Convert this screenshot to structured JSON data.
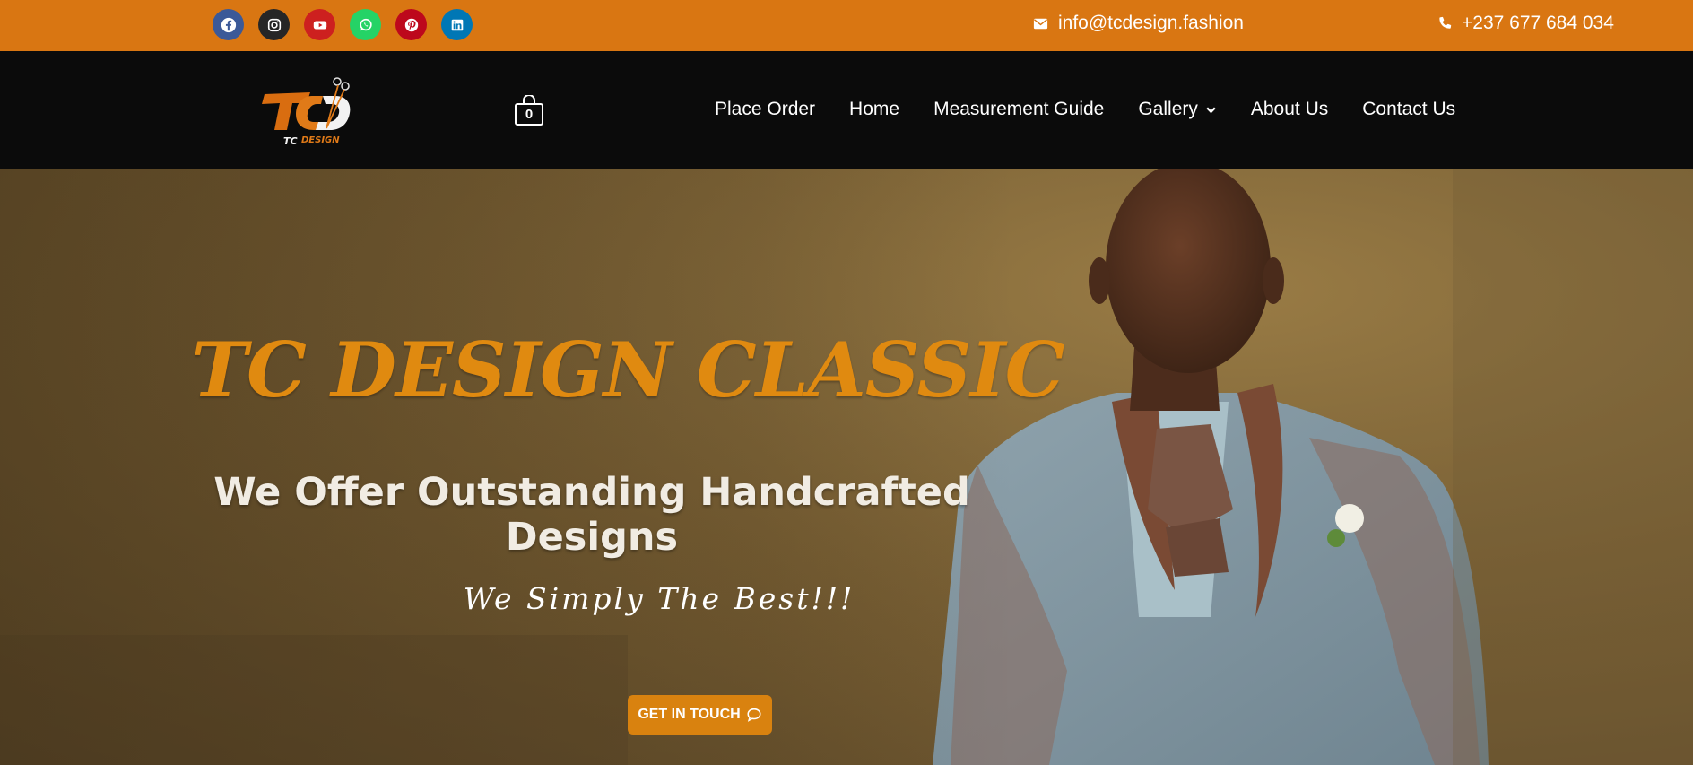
{
  "topbar": {
    "socials": [
      {
        "name": "facebook-icon",
        "color": "#3b5998"
      },
      {
        "name": "instagram-icon",
        "color": "#262626"
      },
      {
        "name": "youtube-icon",
        "color": "#cd201f"
      },
      {
        "name": "whatsapp-icon",
        "color": "#25d366"
      },
      {
        "name": "pinterest-icon",
        "color": "#bd081c"
      },
      {
        "name": "linkedin-icon",
        "color": "#0077b5"
      }
    ],
    "email": "info@tcdesign.fashion",
    "phone": "+237 677 684 034"
  },
  "header": {
    "cart_count": "0",
    "nav": [
      {
        "label": "Place Order"
      },
      {
        "label": "Home"
      },
      {
        "label": "Measurement Guide"
      },
      {
        "label": "Gallery"
      },
      {
        "label": "About Us"
      },
      {
        "label": "Contact Us"
      }
    ]
  },
  "hero": {
    "title": "TC DESIGN CLASSIC",
    "subtitle": "We Offer Outstanding Handcrafted Designs",
    "tagline": "We Simply The Best!!!",
    "cta_label": "GET IN TOUCH"
  },
  "colors": {
    "topbar": "#d97612",
    "header": "#0b0b0b",
    "accent": "#e08a10"
  }
}
